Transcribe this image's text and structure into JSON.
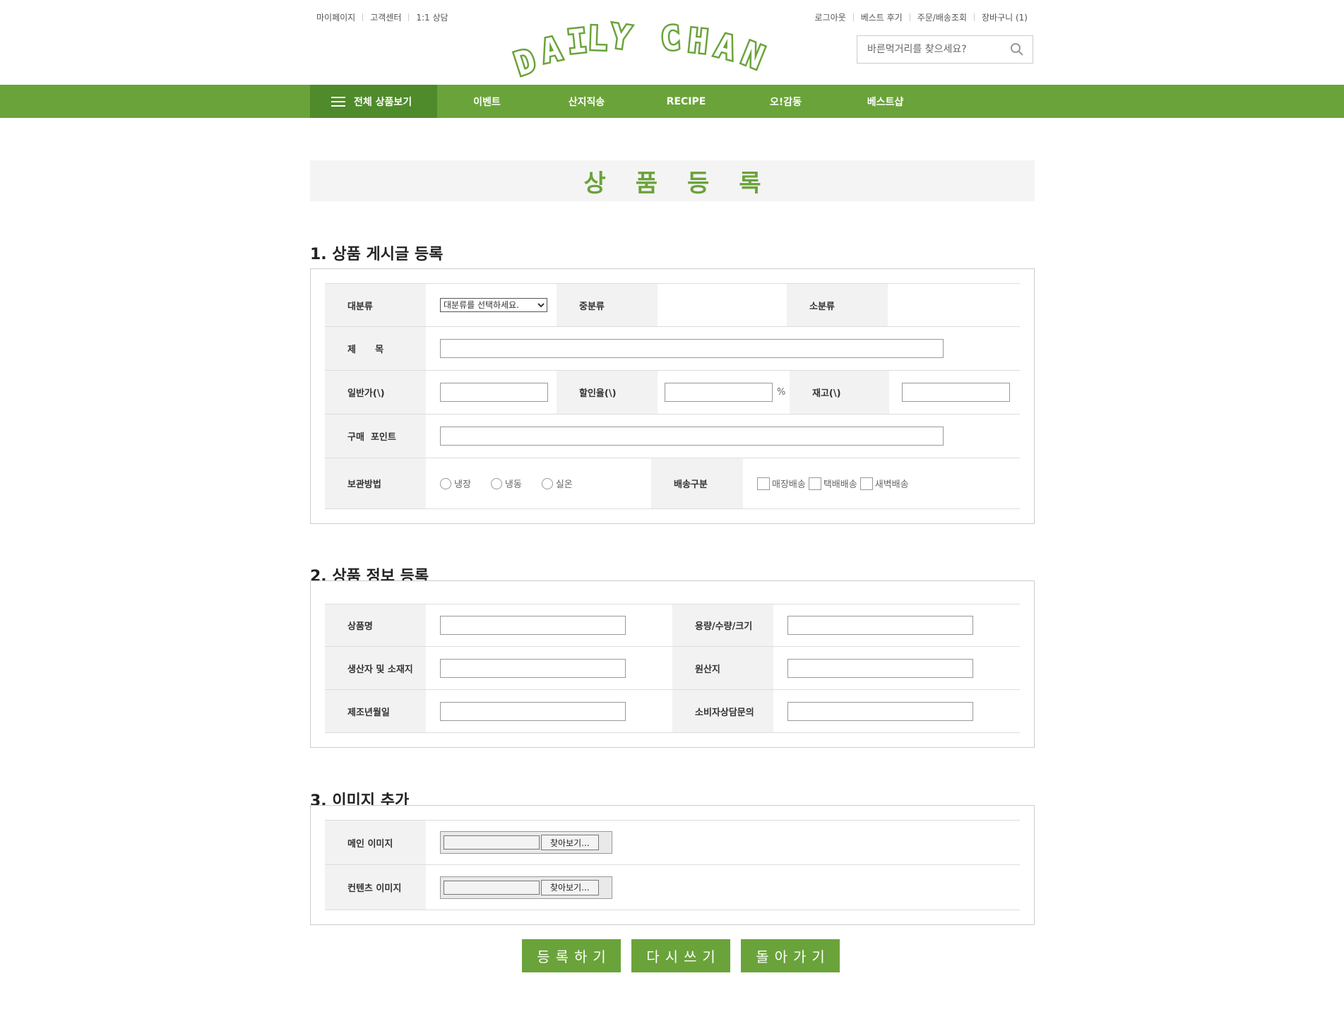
{
  "util_left": [
    "마이페이지",
    "고객센터",
    "1:1 상담"
  ],
  "util_right": [
    "로그아웃",
    "베스트 후기",
    "주문/배송조회",
    "장바구니 (1)"
  ],
  "logo": {
    "text": "DAILY CHAN"
  },
  "search": {
    "placeholder": "바른먹거리를 찾으세요?",
    "icon": "search-icon"
  },
  "gnb": {
    "all_label": "전체 상품보기",
    "items": [
      "이벤트",
      "산지직송",
      "RECIPE",
      "오!감동",
      "베스트샵"
    ]
  },
  "page_title": "상품등록",
  "section1": {
    "title": "1. 상품 게시글 등록",
    "category_large": "대분류",
    "category_large_select": "대분류를 선택하세요.",
    "category_mid": "중분류",
    "category_small": "소분류",
    "subject": "제      목",
    "price": "일반가(\\)",
    "discount": "할인율(\\)",
    "percent": "%",
    "stock": "재고(\\)",
    "point": "구매  포인트",
    "storage": "보관방법",
    "storage_options": [
      "냉장",
      "냉동",
      "실온"
    ],
    "delivery": "배송구분",
    "delivery_options": [
      "매장배송",
      "택배배송",
      "새벽배송"
    ]
  },
  "section2": {
    "title": "2. 상품 정보 등록",
    "product_name": "상품명",
    "capacity": "용량/수량/크기",
    "producer": "생산자 및 소재지",
    "origin": "원산지",
    "made_date": "제조년월일",
    "consumer_inquiry": "소비자상담문의"
  },
  "section3": {
    "title": "3. 이미지 추가",
    "main_image": "메인 이미지",
    "content_image": "컨텐츠 이미지",
    "browse": "찾아보기..."
  },
  "buttons": {
    "submit": "등록하기",
    "reset": "다시쓰기",
    "back": "돌아가기"
  },
  "colors": {
    "brand_green": "#6aa33a",
    "dark_green": "#4f8a2b",
    "label_bg": "#f2f2f2"
  }
}
